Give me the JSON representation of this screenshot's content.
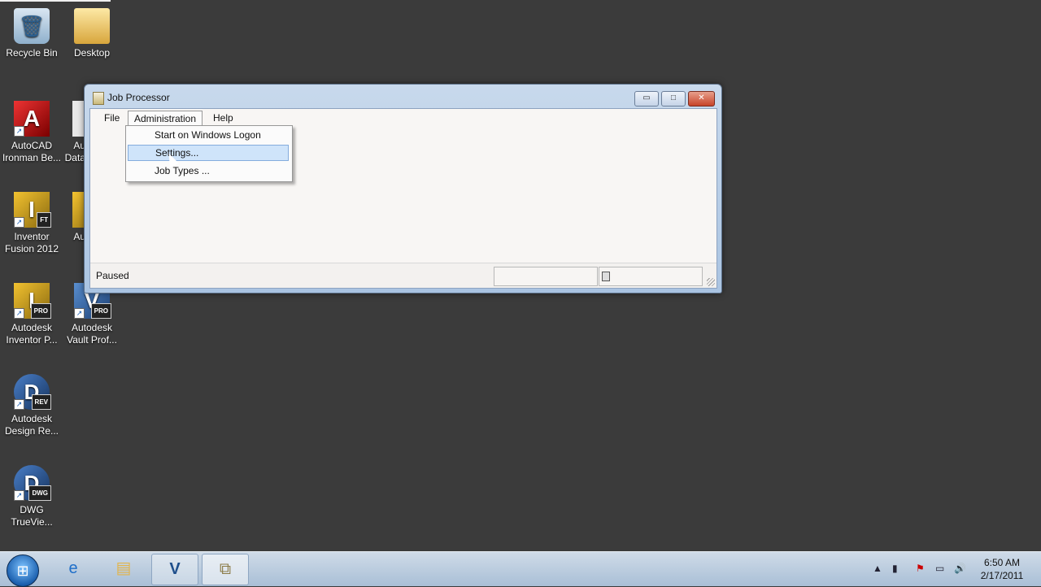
{
  "desktop": {
    "icons": [
      {
        "label": "Recycle Bin",
        "glyph": "🗑",
        "badge": ""
      },
      {
        "label": "Desktop",
        "glyph": "📁",
        "badge": ""
      },
      {
        "label": "AutoCAD Ironman Be...",
        "glyph": "A",
        "badge": ""
      },
      {
        "label": "Au Data",
        "glyph": "A",
        "badge": ""
      },
      {
        "label": "Inventor Fusion 2012",
        "glyph": "I",
        "badge": "FT"
      },
      {
        "label": "Au",
        "glyph": "A",
        "badge": ""
      },
      {
        "label": "Autodesk Inventor P...",
        "glyph": "I",
        "badge": "PRO"
      },
      {
        "label": "Autodesk Vault Prof...",
        "glyph": "V",
        "badge": "PRO"
      },
      {
        "label": "Autodesk Design Re...",
        "glyph": "D",
        "badge": "REV"
      },
      {
        "label": "DWG TrueVie...",
        "glyph": "D",
        "badge": "DWG"
      }
    ]
  },
  "window": {
    "title": "Job Processor",
    "controls": {
      "minimize": "▭",
      "maximize": "□",
      "close": "✕"
    },
    "menu": {
      "file": "File",
      "administration": "Administration",
      "help": "Help"
    },
    "dropdown": {
      "items": [
        "Start on Windows Logon",
        "Settings...",
        "Job Types ..."
      ],
      "highlighted_index": 1
    },
    "status": {
      "text": "Paused"
    }
  },
  "taskbar": {
    "start_glyph": "⊞",
    "apps": {
      "ie": "e",
      "folder": "▤",
      "vault": "V",
      "job": "⧉"
    },
    "tray": {
      "up_arrow": "▲",
      "flag": "⚑",
      "network": "▭",
      "volume": "🔊"
    },
    "clock": {
      "time": "6:50 AM",
      "date": "2/17/2011"
    }
  },
  "colors": {
    "desktop_bg": "#3b3b3b",
    "menu_highlight": "#cfe4fa",
    "highlight_border": "#84acdd"
  }
}
